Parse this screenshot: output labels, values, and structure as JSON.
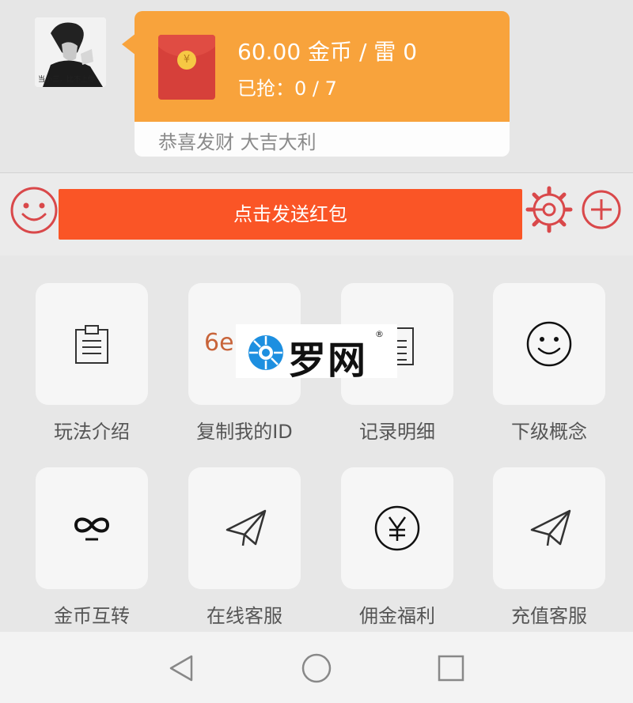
{
  "chat": {
    "avatar": {
      "caption": "当小三，比不上你"
    },
    "red_packet": {
      "amount_text": "60.00 金币 / 雷 0",
      "grabbed_text": "已抢：0 / 7",
      "blessing": "恭喜发财 大吉大利",
      "coin_symbol": "¥",
      "color": "#f8a33c"
    }
  },
  "input_bar": {
    "send_label": "点击发送红包",
    "send_color": "#fa5526",
    "icons": [
      "smiley-icon",
      "gear-icon",
      "plus-icon"
    ],
    "icon_color": "#d9484a"
  },
  "grid": {
    "items": [
      {
        "label": "玩法介绍",
        "icon": "clipboard-icon"
      },
      {
        "label": "复制我的ID",
        "icon": "id-text-icon",
        "preview": "6e"
      },
      {
        "label": "记录明细",
        "icon": "document-icon"
      },
      {
        "label": "下级概念",
        "icon": "smiley-icon"
      },
      {
        "label": "金币互转",
        "icon": "infinity-icon"
      },
      {
        "label": "在线客服",
        "icon": "paper-plane-icon"
      },
      {
        "label": "佣金福利",
        "icon": "yen-coin-icon",
        "symbol": "¥"
      },
      {
        "label": "充值客服",
        "icon": "paper-plane-icon"
      }
    ]
  },
  "watermark": {
    "text": "罗网",
    "registered": "®"
  },
  "nav_bar": {
    "icons": [
      "back-triangle-icon",
      "home-circle-icon",
      "recents-square-icon"
    ]
  }
}
